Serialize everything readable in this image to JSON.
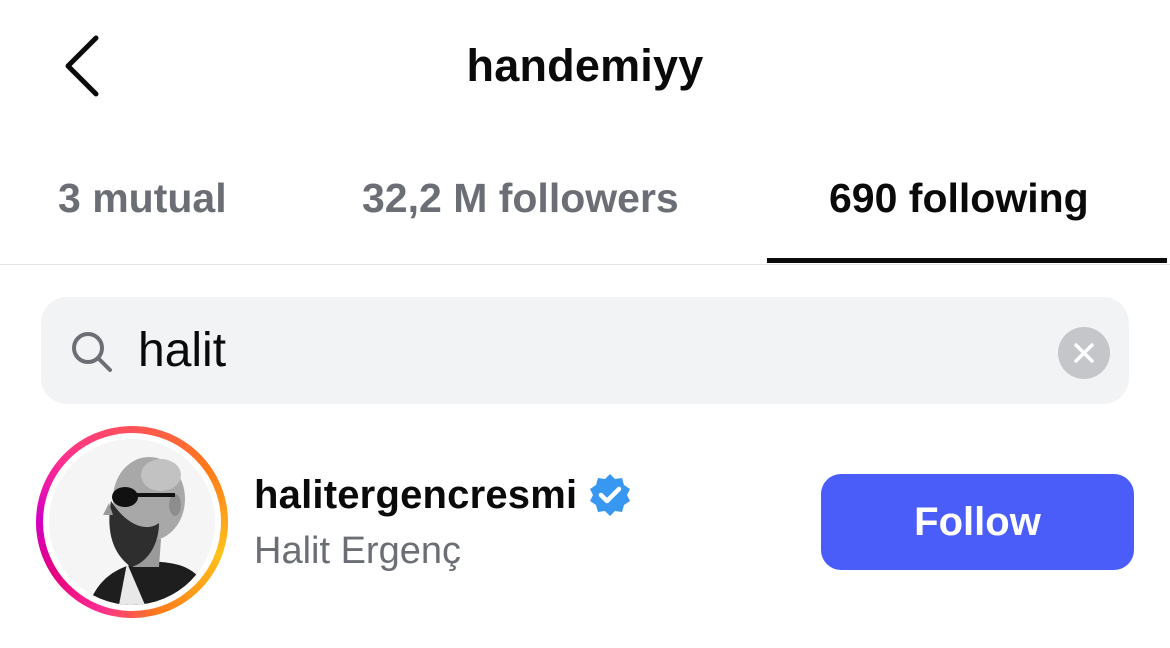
{
  "header": {
    "title": "handemiyy",
    "back_icon": "chevron-left-icon"
  },
  "tabs": [
    {
      "label": "3 mutual",
      "active": false
    },
    {
      "label": "32,2 M followers",
      "active": false
    },
    {
      "label": "690 following",
      "active": true
    }
  ],
  "search": {
    "value": "halit",
    "icon": "search-icon",
    "clear_icon": "clear-icon"
  },
  "results": [
    {
      "username": "halitergencresmi",
      "full_name": "Halit Ergenç",
      "verified": true,
      "follow_label": "Follow"
    }
  ],
  "colors": {
    "follow_button": "#4a5df9",
    "verified_badge": "#3897f0",
    "search_background": "#f2f3f5",
    "secondary_text": "#6b6f75"
  }
}
